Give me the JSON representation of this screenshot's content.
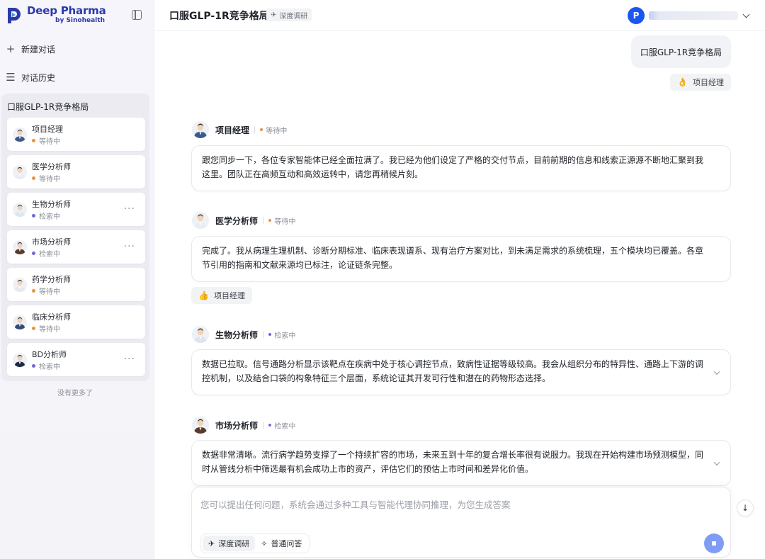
{
  "brand": {
    "title": "Deep Pharma",
    "subtitle": "by Sinohealth",
    "colors": {
      "primary": "#2b3aa8",
      "accent": "#1a56f0",
      "waiting": "#f0903a",
      "searching": "#6b6ad8"
    }
  },
  "sidebar": {
    "new_chat": "新建对话",
    "history": "对话历史",
    "project_title": "口服GLP-1R竞争格局",
    "agents": [
      {
        "name": "项目经理",
        "status": "等待中",
        "status_type": "waiting",
        "has_menu": false,
        "avatar": "manager"
      },
      {
        "name": "医学分析师",
        "status": "等待中",
        "status_type": "waiting",
        "has_menu": false,
        "avatar": "doctor"
      },
      {
        "name": "生物分析师",
        "status": "检索中",
        "status_type": "searching",
        "has_menu": true,
        "avatar": "scientist"
      },
      {
        "name": "市场分析师",
        "status": "检索中",
        "status_type": "searching",
        "has_menu": true,
        "avatar": "woman"
      },
      {
        "name": "药学分析师",
        "status": "等待中",
        "status_type": "waiting",
        "has_menu": false,
        "avatar": "pharmacist"
      },
      {
        "name": "临床分析师",
        "status": "等待中",
        "status_type": "waiting",
        "has_menu": false,
        "avatar": "clinician"
      },
      {
        "name": "BD分析师",
        "status": "检索中",
        "status_type": "searching",
        "has_menu": true,
        "avatar": "suit"
      }
    ],
    "more_dots": "···",
    "no_more": "没有更多了"
  },
  "header": {
    "title": "口服GLP-1R竞争格局",
    "mode_tag": "深度调研",
    "user_initial": "P"
  },
  "chat": {
    "user_message": "口服GLP-1R竞争格局",
    "user_reaction": {
      "emoji": "👌",
      "label": "项目经理"
    },
    "messages": [
      {
        "agent": "项目经理",
        "status": "等待中",
        "status_type": "waiting",
        "text": "跟您同步一下，各位专家智能体已经全面拉满了。我已经为他们设定了严格的交付节点，目前前期的信息和线索正源源不断地汇聚到我这里。团队正在高频互动和高效运转中，请您再稍候片刻。"
      },
      {
        "agent": "医学分析师",
        "status": "等待中",
        "status_type": "waiting",
        "text": "完成了。我从病理生理机制、诊断分期标准、临床表现谱系、现有治疗方案对比，到未满足需求的系统梳理，五个模块均已覆盖。各章节引用的指南和文献来源均已标注，论证链条完整。"
      },
      {
        "agent": "生物分析师",
        "status": "检索中",
        "status_type": "searching",
        "text": "数据已拉取。信号通路分析显示该靶点在疾病中处于核心调控节点，致病性证据等级较高。我会从组织分布的特异性、通路上下游的调控机制，以及结合口袋的构象特征三个层面，系统论证其开发可行性和潜在的药物形态选择。"
      },
      {
        "agent": "市场分析师",
        "status": "检索中",
        "status_type": "searching",
        "text": "数据非常清晰。流行病学趋势支撑了一个持续扩容的市场，未来五到十年的复合增长率很有说服力。我现在开始构建市场预测模型，同时从管线分析中筛选最有机会成功上市的资产，评估它们的预估上市时间和差异化价值。"
      }
    ],
    "medical_reaction": {
      "emoji": "👍",
      "label": "项目经理"
    }
  },
  "composer": {
    "placeholder": "您可以提出任何问题，系统会通过多种工具与智能代理协同推理，为您生成答案",
    "modes": [
      {
        "label": "深度调研",
        "icon": "telescope-icon",
        "active": true
      },
      {
        "label": "普通问答",
        "icon": "sparkle-icon",
        "active": false
      }
    ]
  }
}
